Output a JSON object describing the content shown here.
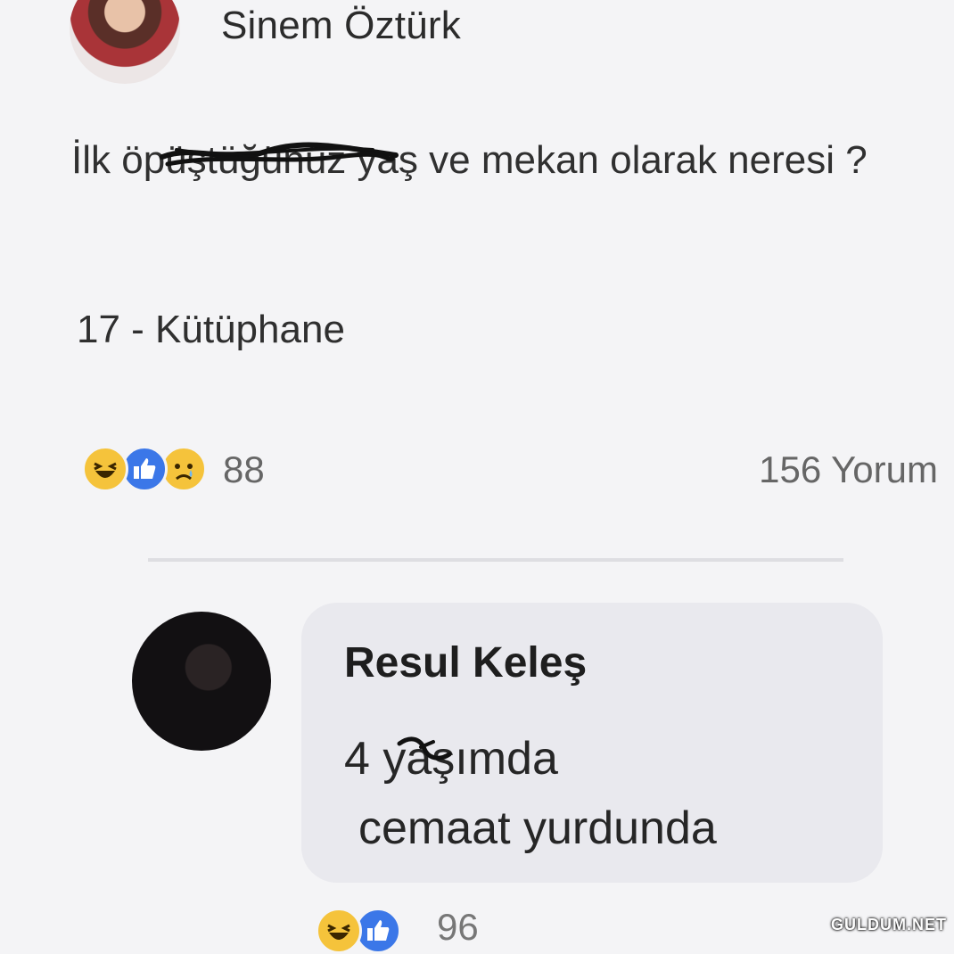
{
  "post": {
    "author": "Sinem Öztürk",
    "text": "İlk öpüştüğünüz yaş ve mekan olarak neresi ?",
    "answer": "17 - Kütüphane",
    "reaction_count": "88",
    "comment_count": "156 Yorum"
  },
  "comment": {
    "author": "Resul Keleş",
    "line1": "4 yaşımda",
    "line2": "cemaat yurdunda",
    "reaction_count": "96"
  },
  "icons": {
    "haha": "haha-emoji-icon",
    "like": "thumbs-up-icon",
    "sad": "sad-emoji-icon"
  },
  "colors": {
    "background": "#f4f4f6",
    "bubble": "#e9e9ee",
    "like_blue": "#3b77e8",
    "emoji_yellow": "#f5c33b"
  },
  "watermark": "GULDUM.NET"
}
